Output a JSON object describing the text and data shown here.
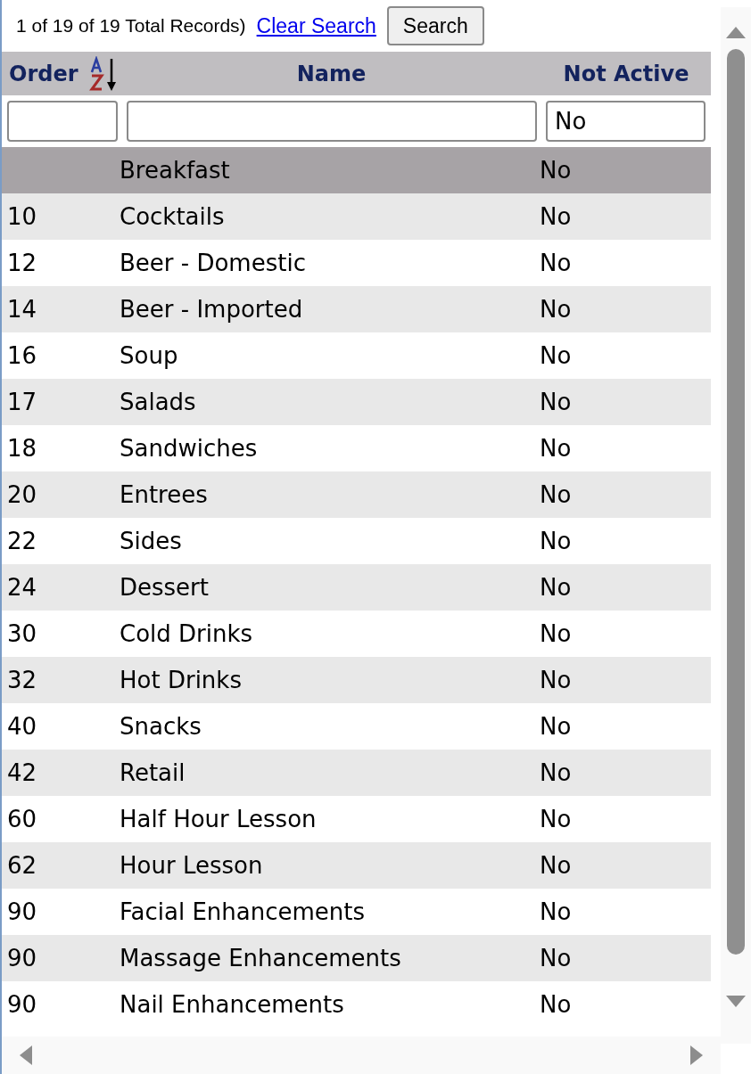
{
  "toolbar": {
    "record_count": "1 of 19 of 19 Total Records)",
    "clear_link": "Clear Search",
    "search_button": "Search"
  },
  "table": {
    "columns": [
      {
        "label": "Order",
        "sorted": true
      },
      {
        "label": "Name",
        "sorted": false
      },
      {
        "label": "Not Active",
        "sorted": false,
        "filter": "No"
      }
    ],
    "rows": [
      {
        "order": "",
        "name": "Breakfast",
        "not_active": "No",
        "selected": true
      },
      {
        "order": "10",
        "name": "Cocktails",
        "not_active": "No",
        "selected": false
      },
      {
        "order": "12",
        "name": "Beer - Domestic",
        "not_active": "No",
        "selected": false
      },
      {
        "order": "14",
        "name": "Beer - Imported",
        "not_active": "No",
        "selected": false
      },
      {
        "order": "16",
        "name": "Soup",
        "not_active": "No",
        "selected": false
      },
      {
        "order": "17",
        "name": "Salads",
        "not_active": "No",
        "selected": false
      },
      {
        "order": "18",
        "name": "Sandwiches",
        "not_active": "No",
        "selected": false
      },
      {
        "order": "20",
        "name": "Entrees",
        "not_active": "No",
        "selected": false
      },
      {
        "order": "22",
        "name": "Sides",
        "not_active": "No",
        "selected": false
      },
      {
        "order": "24",
        "name": "Dessert",
        "not_active": "No",
        "selected": false
      },
      {
        "order": "30",
        "name": "Cold Drinks",
        "not_active": "No",
        "selected": false
      },
      {
        "order": "32",
        "name": "Hot Drinks",
        "not_active": "No",
        "selected": false
      },
      {
        "order": "40",
        "name": "Snacks",
        "not_active": "No",
        "selected": false
      },
      {
        "order": "42",
        "name": "Retail",
        "not_active": "No",
        "selected": false
      },
      {
        "order": "60",
        "name": "Half Hour Lesson",
        "not_active": "No",
        "selected": false
      },
      {
        "order": "62",
        "name": "Hour Lesson",
        "not_active": "No",
        "selected": false
      },
      {
        "order": "90",
        "name": "Facial Enhancements",
        "not_active": "No",
        "selected": false
      },
      {
        "order": "90",
        "name": "Massage Enhancements",
        "not_active": "No",
        "selected": false
      },
      {
        "order": "90",
        "name": "Nail Enhancements",
        "not_active": "No",
        "selected": false
      }
    ]
  }
}
